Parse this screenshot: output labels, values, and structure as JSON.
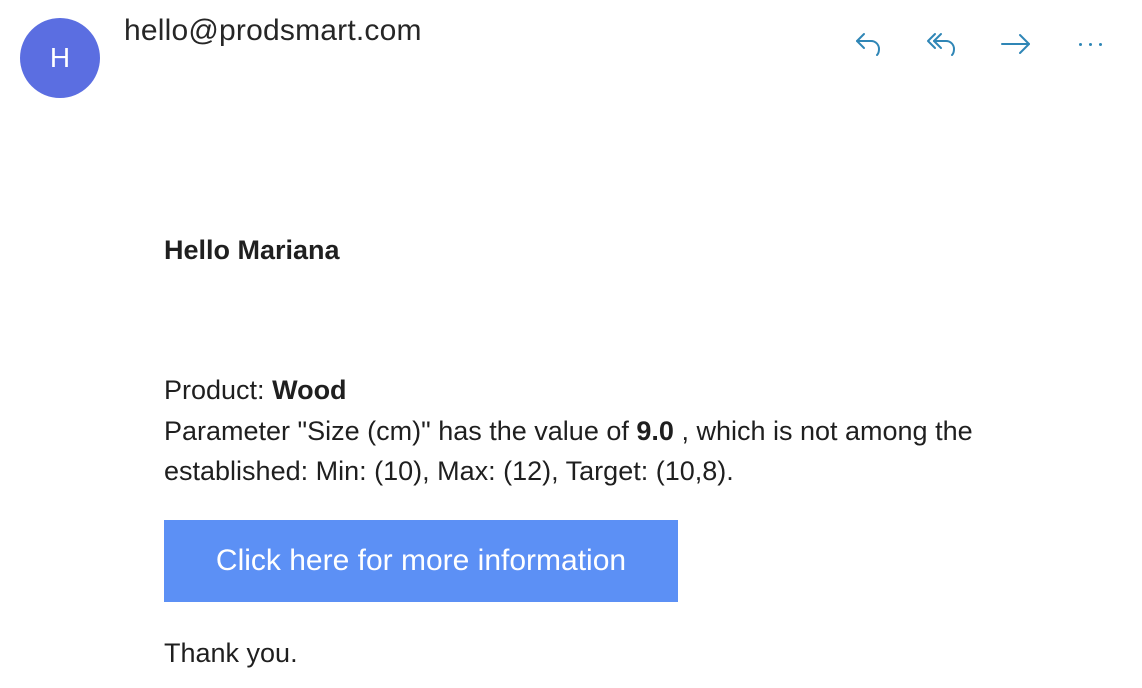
{
  "header": {
    "avatar_initial": "H",
    "sender": "hello@prodsmart.com",
    "actions": {
      "reply_icon": "reply-icon",
      "reply_all_icon": "reply-all-icon",
      "forward_icon": "forward-icon",
      "more_icon": "more-options-icon"
    },
    "accent_color": "#2f86b6",
    "avatar_color": "#5b6ee1"
  },
  "message": {
    "greeting": "Hello Mariana",
    "product_label": "Product:",
    "product_name": "Wood",
    "param_prefix": "Parameter \"Size (cm)\" has the value of",
    "param_value": "9.0",
    "param_suffix": ", which is not among the established: Min: (10), Max: (12), Target: (10,8).",
    "cta_label": "Click here for more information",
    "cta_color": "#5c90f5",
    "closing": "Thank you."
  }
}
